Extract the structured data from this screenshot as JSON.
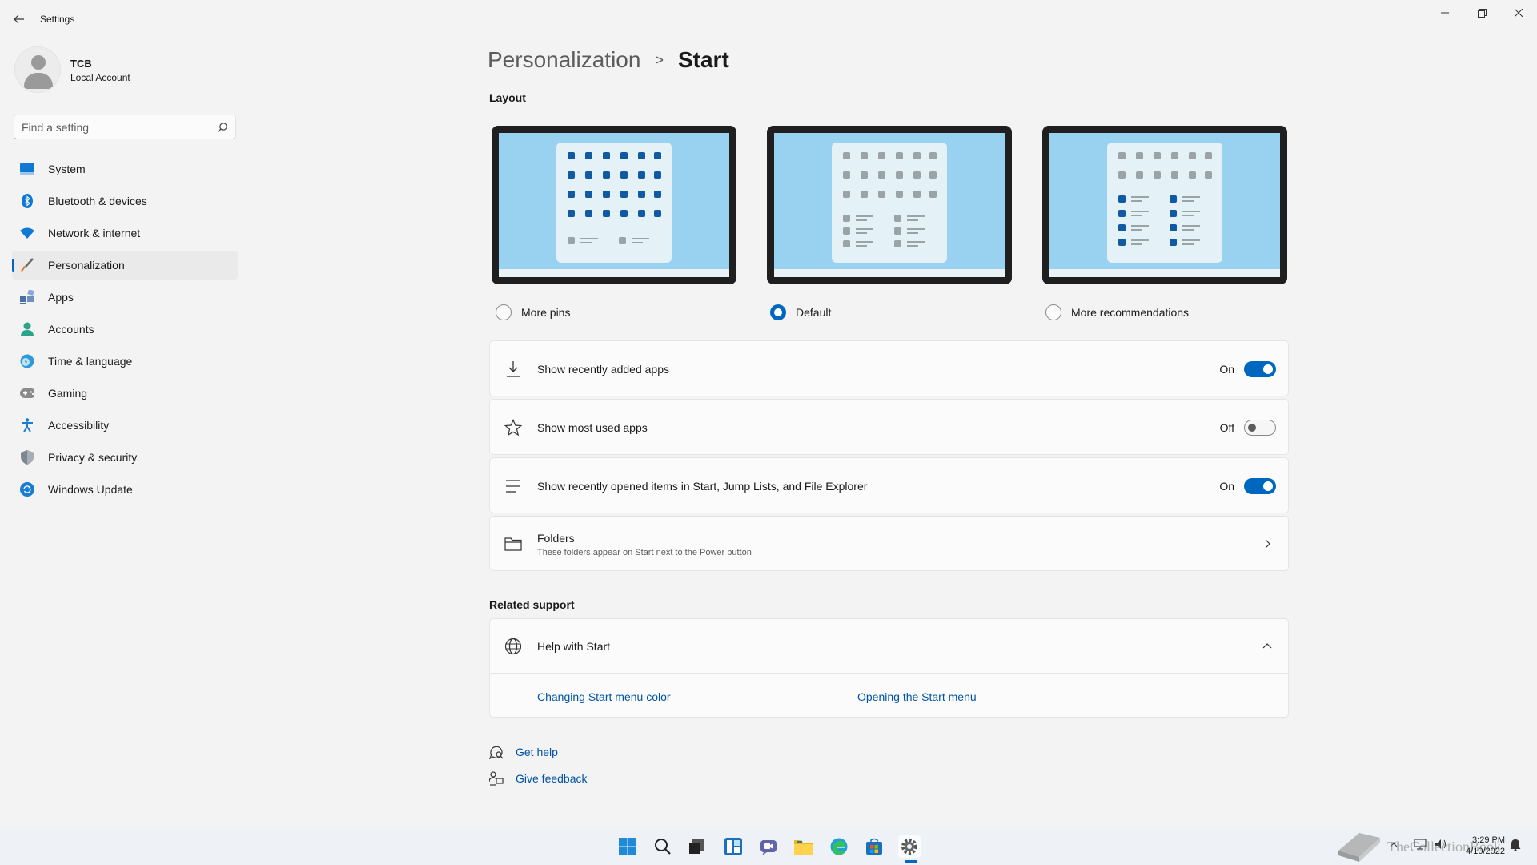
{
  "window": {
    "title": "Settings"
  },
  "user": {
    "name": "TCB",
    "account_type": "Local Account"
  },
  "search": {
    "placeholder": "Find a setting",
    "value": ""
  },
  "sidebar": {
    "items": [
      {
        "label": "System",
        "icon": "monitor-icon",
        "color": "#0f78d4"
      },
      {
        "label": "Bluetooth & devices",
        "icon": "bluetooth-icon",
        "color": "#0f78d4"
      },
      {
        "label": "Network & internet",
        "icon": "wifi-icon",
        "color": "#0f78d4"
      },
      {
        "label": "Personalization",
        "icon": "brush-icon",
        "color": "#e07a3a",
        "active": true
      },
      {
        "label": "Apps",
        "icon": "apps-icon",
        "color": "#4a6fa5"
      },
      {
        "label": "Accounts",
        "icon": "person-icon",
        "color": "#2ba58a"
      },
      {
        "label": "Time & language",
        "icon": "globe-clock-icon",
        "color": "#2f9ad8"
      },
      {
        "label": "Gaming",
        "icon": "gamepad-icon",
        "color": "#7a7a7a"
      },
      {
        "label": "Accessibility",
        "icon": "accessibility-icon",
        "color": "#1a7cd3"
      },
      {
        "label": "Privacy & security",
        "icon": "shield-icon",
        "color": "#7d8590"
      },
      {
        "label": "Windows Update",
        "icon": "update-icon",
        "color": "#1a7cd3"
      }
    ]
  },
  "breadcrumb": {
    "parent": "Personalization",
    "separator": ">",
    "current": "Start"
  },
  "layout_section": {
    "title": "Layout",
    "options": [
      {
        "label": "More pins",
        "selected": false
      },
      {
        "label": "Default",
        "selected": true
      },
      {
        "label": "More recommendations",
        "selected": false
      }
    ]
  },
  "settings": [
    {
      "title": "Show recently added apps",
      "icon": "download-icon",
      "state": "On",
      "on": true
    },
    {
      "title": "Show most used apps",
      "icon": "star-icon",
      "state": "Off",
      "on": false
    },
    {
      "title": "Show recently opened items in Start, Jump Lists, and File Explorer",
      "icon": "list-icon",
      "state": "On",
      "on": true
    }
  ],
  "folders": {
    "title": "Folders",
    "subtitle": "These folders appear on Start next to the Power button"
  },
  "related_support": {
    "title": "Related support",
    "help_title": "Help with Start",
    "links": [
      "Changing Start menu color",
      "Opening the Start menu"
    ]
  },
  "footer_links": {
    "get_help": "Get help",
    "give_feedback": "Give feedback"
  },
  "taskbar": {
    "apps": [
      "windows-start-icon",
      "search-icon",
      "task-view-icon",
      "widgets-icon",
      "teams-chat-icon",
      "file-explorer-icon",
      "edge-icon",
      "store-icon",
      "settings-icon"
    ],
    "time": "3:29 PM",
    "date": "4/10/2022"
  },
  "watermark": {
    "text": "TheCollectionBook"
  },
  "colors": {
    "accent": "#0067c0",
    "background": "#f3f3f3",
    "card": "#fbfbfb"
  }
}
